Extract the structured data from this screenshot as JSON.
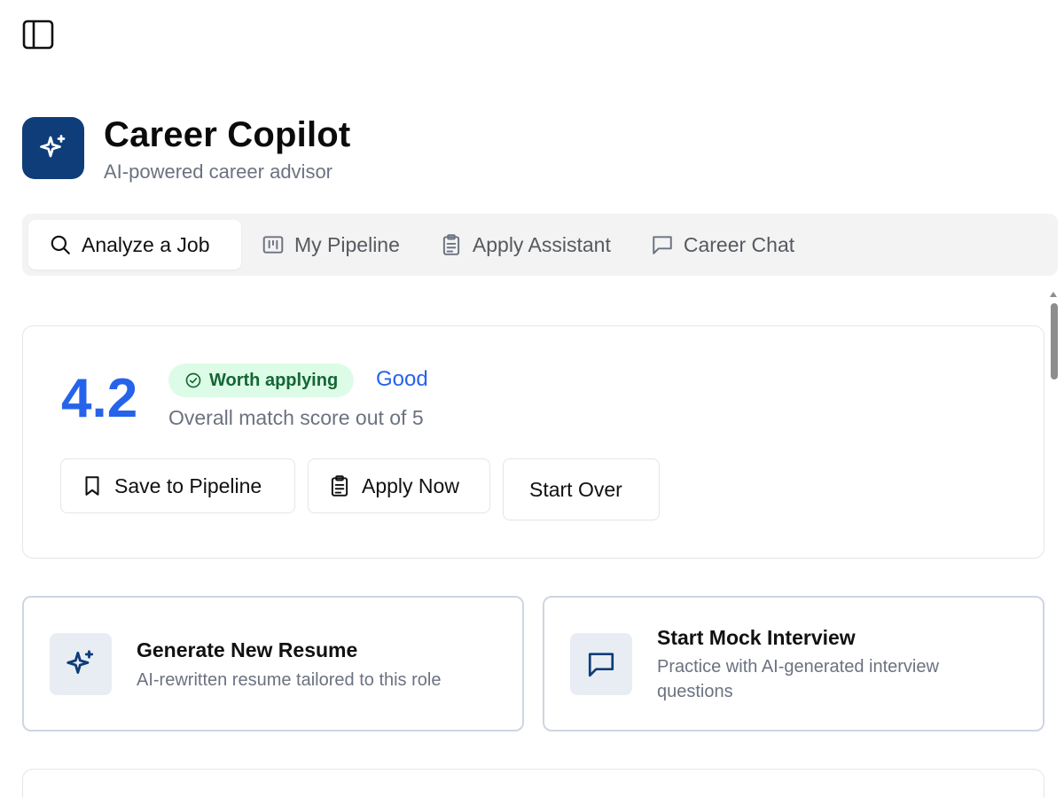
{
  "icons": {
    "sidebar_toggle": "sidebar-panel-icon",
    "brand": "sparkles-icon",
    "tab_analyze": "search-icon",
    "tab_pipeline": "kanban-icon",
    "tab_apply": "clipboard-icon",
    "tab_chat": "message-square-icon",
    "badge": "check-circle-icon",
    "save": "bookmark-icon",
    "apply": "clipboard-icon",
    "resume": "sparkles-icon",
    "interview": "message-square-icon"
  },
  "colors": {
    "brand": "#0f3d7a",
    "accent": "#2563eb",
    "badge_bg": "#dcfce7",
    "badge_text": "#166534"
  },
  "brand": {
    "title": "Career Copilot",
    "subtitle": "AI-powered career advisor"
  },
  "tabs": [
    {
      "label": "Analyze a Job",
      "active": true
    },
    {
      "label": "My Pipeline",
      "active": false
    },
    {
      "label": "Apply Assistant",
      "active": false
    },
    {
      "label": "Career Chat",
      "active": false
    }
  ],
  "score": {
    "value": "4.2",
    "badge": "Worth applying",
    "rating": "Good",
    "caption": "Overall match score out of 5"
  },
  "actions": {
    "save": "Save to Pipeline",
    "apply": "Apply Now",
    "start_over": "Start Over"
  },
  "cards": [
    {
      "title": "Generate New Resume",
      "description": "AI-rewritten resume tailored to this role"
    },
    {
      "title": "Start Mock Interview",
      "description": "Practice with AI-generated interview questions"
    }
  ]
}
